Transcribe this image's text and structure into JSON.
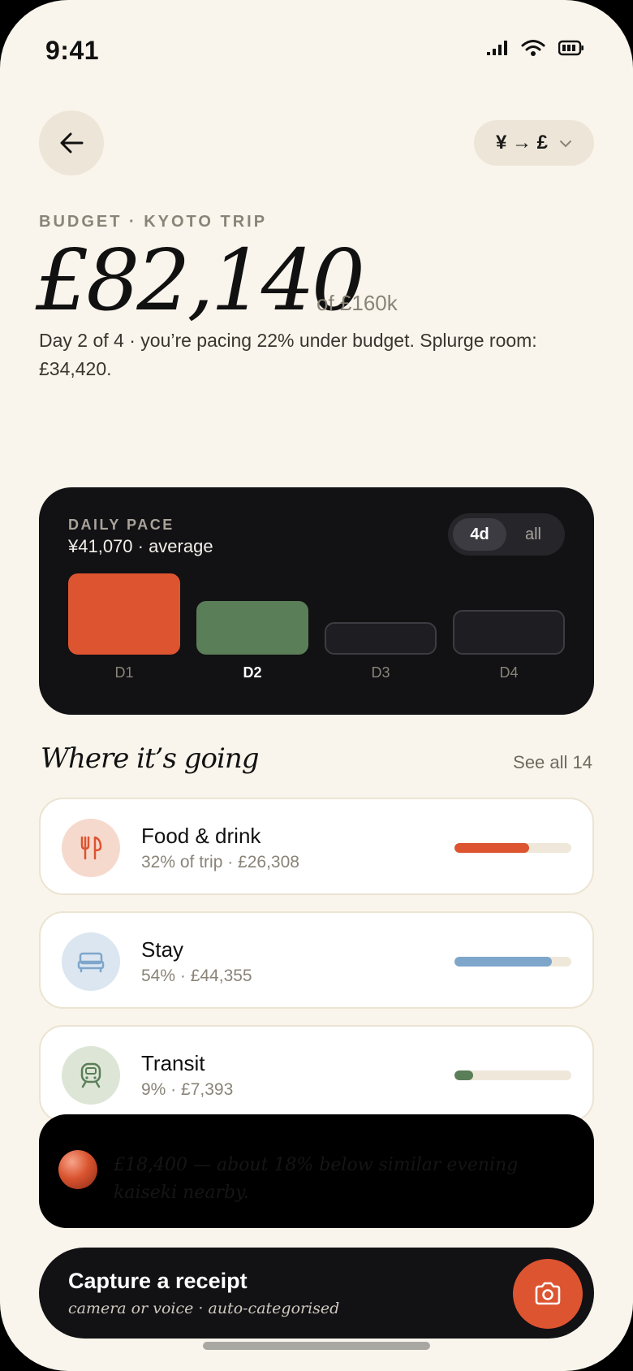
{
  "status_bar": {
    "time": "9:41"
  },
  "header": {
    "currency_pair": "¥ → £"
  },
  "budget": {
    "eyebrow": "BUDGET · KYOTO TRIP",
    "spent": "£82,140",
    "of_total": "of £160k",
    "pace_text": "Day 2 of 4 · you’re pacing 22% under budget. Splurge room: £34,420."
  },
  "daily_pace": {
    "label": "DAILY PACE",
    "average": "¥41,070 · average",
    "toggle": {
      "active": "4d",
      "inactive": "all"
    },
    "days": [
      {
        "label": "D1",
        "level": 1.0,
        "color": "#dd5430",
        "state": "spent"
      },
      {
        "label": "D2",
        "level": 0.66,
        "color": "#5a7e57",
        "state": "today"
      },
      {
        "label": "D3",
        "level": 0.4,
        "color": "#1e1d22",
        "state": "upcoming"
      },
      {
        "label": "D4",
        "level": 0.55,
        "color": "#1e1d22",
        "state": "upcoming"
      }
    ]
  },
  "categories_section": {
    "title": "Where it’s going",
    "see_all": "See all 14",
    "items": [
      {
        "name": "Food & drink",
        "sub": "32% of trip · £26,308",
        "icon": "fork-knife-icon",
        "icon_bg": "#f6d9cd",
        "icon_color": "#dd5430",
        "fill_color": "#dd5430",
        "share": 0.64
      },
      {
        "name": "Stay",
        "sub": "54% · £44,355",
        "icon": "bed-icon",
        "icon_bg": "#dbe6f0",
        "icon_color": "#7ea6cb",
        "fill_color": "#7ea6cb",
        "share": 0.83
      },
      {
        "name": "Transit",
        "sub": "9% · £7,393",
        "icon": "train-icon",
        "icon_bg": "#dde6d6",
        "icon_color": "#5a7e57",
        "fill_color": "#5a7e57",
        "share": 0.16
      }
    ]
  },
  "toast": {
    "text": "£18,400 — about 18% below similar evening kaiseki nearby."
  },
  "capture": {
    "title": "Capture a receipt",
    "subtitle": "camera or voice · auto-categorised"
  }
}
